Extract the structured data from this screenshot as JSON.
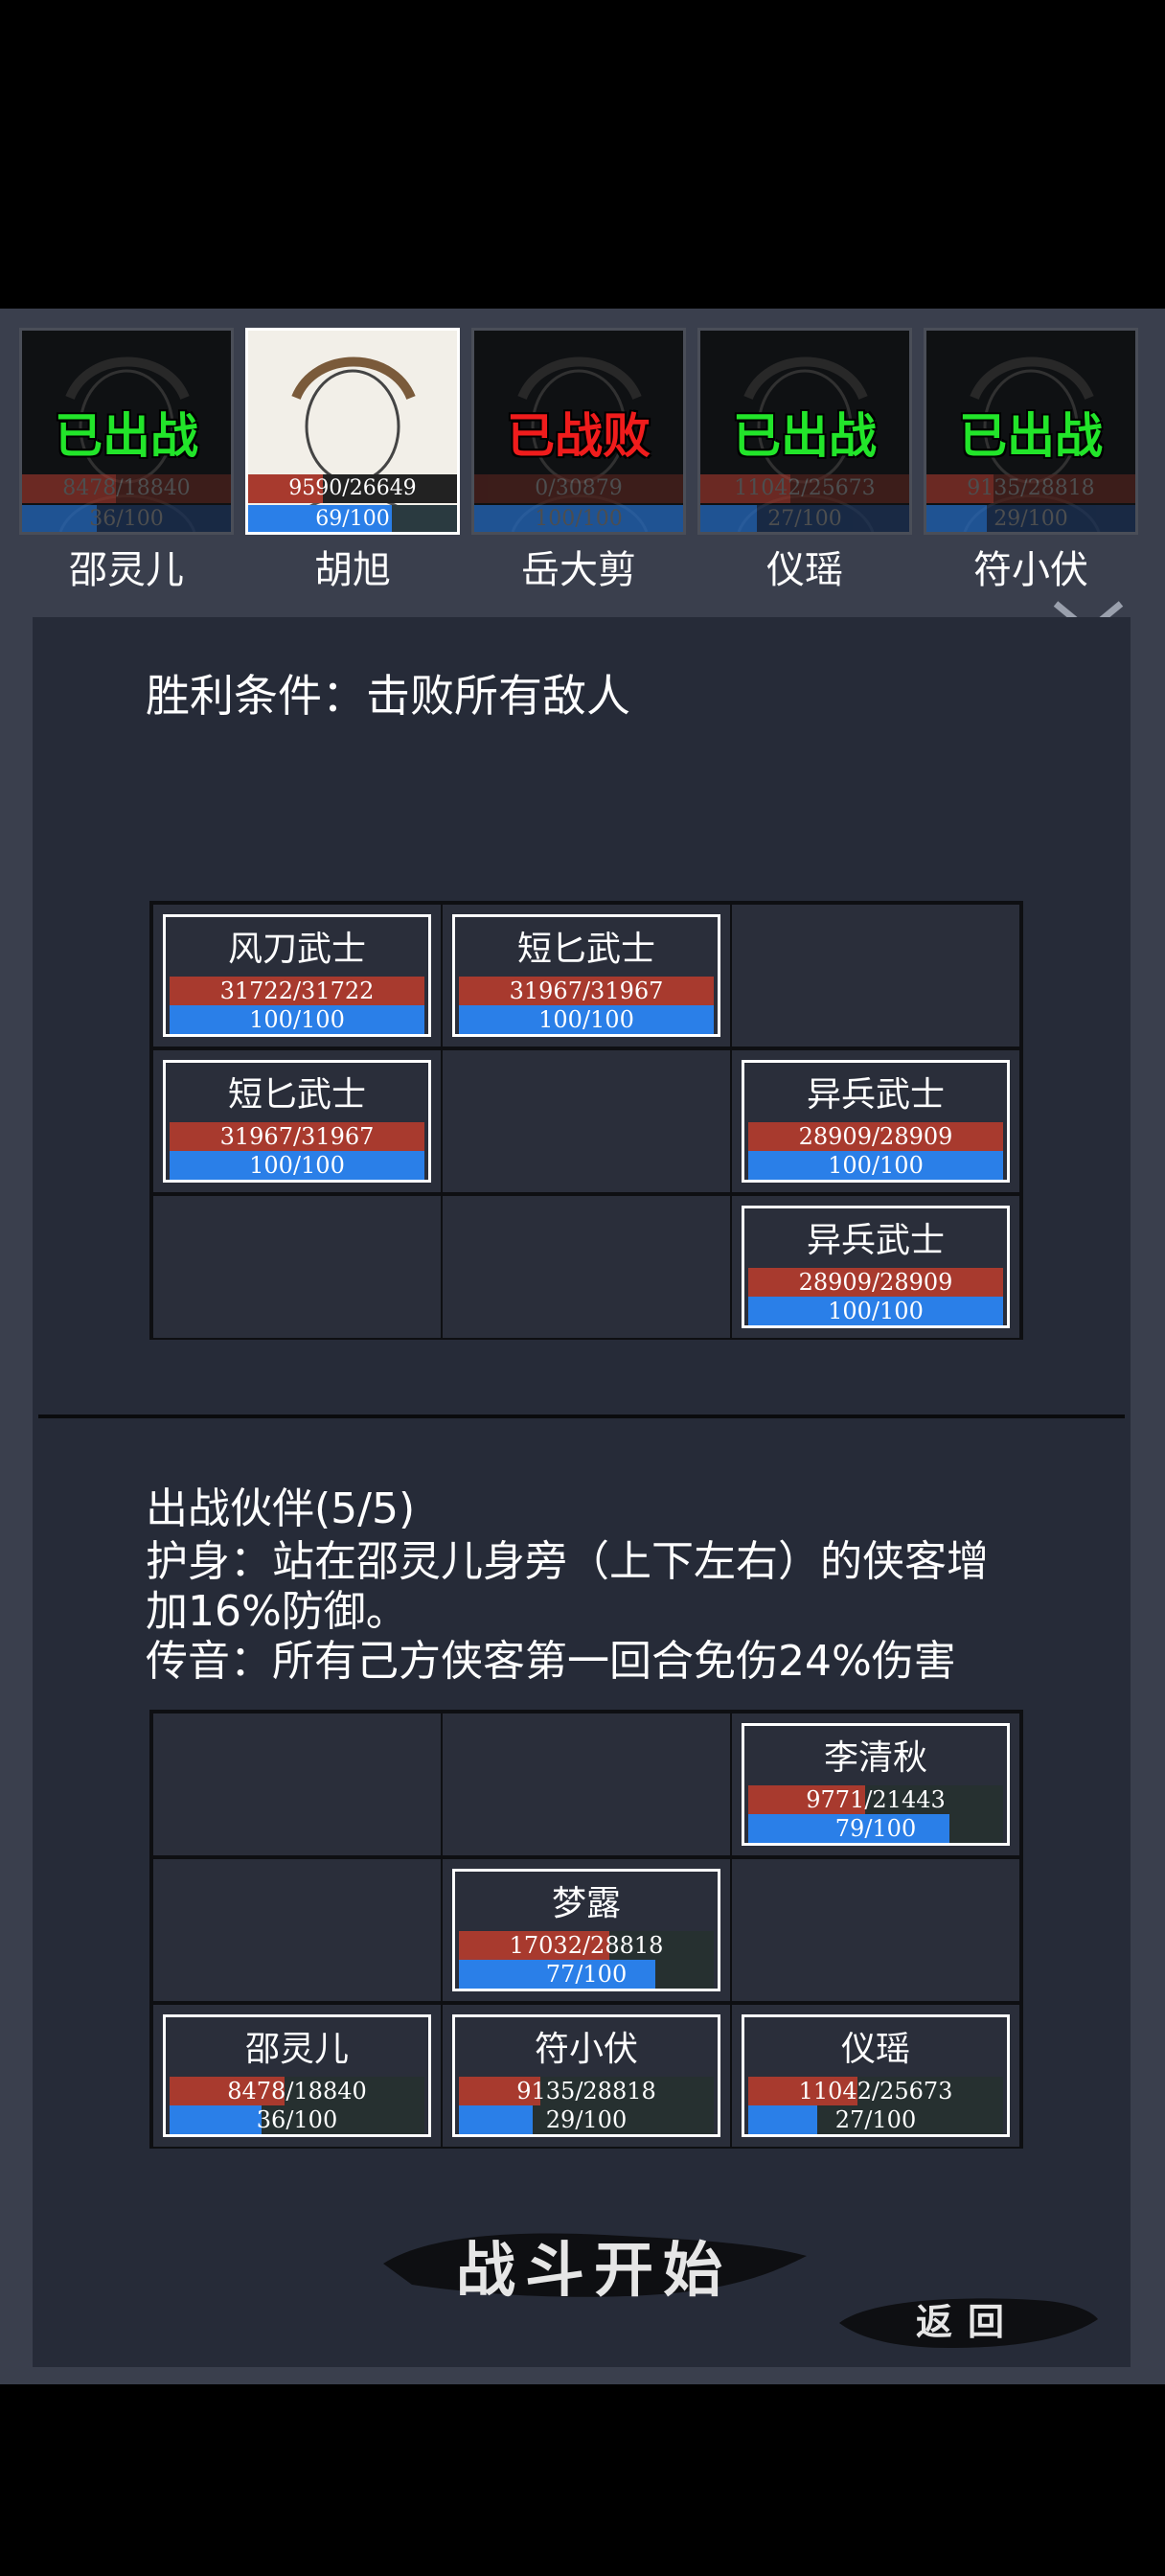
{
  "roster": [
    {
      "name": "邵灵儿",
      "status": "已出战",
      "status_color": "green",
      "hp": "8478/18840",
      "hp_frac": 0.45,
      "mp": "36/100",
      "mp_frac": 0.36,
      "active": false
    },
    {
      "name": "胡旭",
      "status": "",
      "status_color": "",
      "hp": "9590/26649",
      "hp_frac": 0.36,
      "mp": "69/100",
      "mp_frac": 0.69,
      "active": true
    },
    {
      "name": "岳大剪",
      "status": "已战败",
      "status_color": "red",
      "hp": "0/30879",
      "hp_frac": 0,
      "mp": "100/100",
      "mp_frac": 1.0,
      "active": false
    },
    {
      "name": "仪瑶",
      "status": "已出战",
      "status_color": "green",
      "hp": "11042/25673",
      "hp_frac": 0.43,
      "mp": "27/100",
      "mp_frac": 0.27,
      "active": false
    },
    {
      "name": "符小伏",
      "status": "已出战",
      "status_color": "green",
      "hp": "9135/28818",
      "hp_frac": 0.32,
      "mp": "29/100",
      "mp_frac": 0.29,
      "active": false
    }
  ],
  "victory_condition": "胜利条件：击败所有敌人",
  "enemy_units": [
    {
      "name": "风刀武士",
      "hp": "31722/31722",
      "hp_frac": 1.0,
      "mp": "100/100",
      "mp_frac": 1.0,
      "row": 0,
      "col": 0
    },
    {
      "name": "短匕武士",
      "hp": "31967/31967",
      "hp_frac": 1.0,
      "mp": "100/100",
      "mp_frac": 1.0,
      "row": 0,
      "col": 1
    },
    {
      "name": "短匕武士",
      "hp": "31967/31967",
      "hp_frac": 1.0,
      "mp": "100/100",
      "mp_frac": 1.0,
      "row": 1,
      "col": 0
    },
    {
      "name": "异兵武士",
      "hp": "28909/28909",
      "hp_frac": 1.0,
      "mp": "100/100",
      "mp_frac": 1.0,
      "row": 1,
      "col": 2
    },
    {
      "name": "异兵武士",
      "hp": "28909/28909",
      "hp_frac": 1.0,
      "mp": "100/100",
      "mp_frac": 1.0,
      "row": 2,
      "col": 2
    }
  ],
  "party": {
    "title": "出战伙伴(5/5)",
    "skill_1": "护身：站在邵灵儿身旁（上下左右）的侠客增加16%防御。",
    "skill_2": "传音：所有己方侠客第一回合免伤24%伤害"
  },
  "ally_units": [
    {
      "name": "李清秋",
      "hp": "9771/21443",
      "hp_frac": 0.46,
      "mp": "79/100",
      "mp_frac": 0.79,
      "row": 0,
      "col": 2
    },
    {
      "name": "梦露",
      "hp": "17032/28818",
      "hp_frac": 0.59,
      "mp": "77/100",
      "mp_frac": 0.77,
      "row": 1,
      "col": 1
    },
    {
      "name": "邵灵儿",
      "hp": "8478/18840",
      "hp_frac": 0.45,
      "mp": "36/100",
      "mp_frac": 0.36,
      "row": 2,
      "col": 0
    },
    {
      "name": "符小伏",
      "hp": "9135/28818",
      "hp_frac": 0.32,
      "mp": "29/100",
      "mp_frac": 0.29,
      "row": 2,
      "col": 1
    },
    {
      "name": "仪瑶",
      "hp": "11042/25673",
      "hp_frac": 0.43,
      "mp": "27/100",
      "mp_frac": 0.27,
      "row": 2,
      "col": 2
    }
  ],
  "buttons": {
    "start": "战斗开始",
    "back": "返回"
  }
}
